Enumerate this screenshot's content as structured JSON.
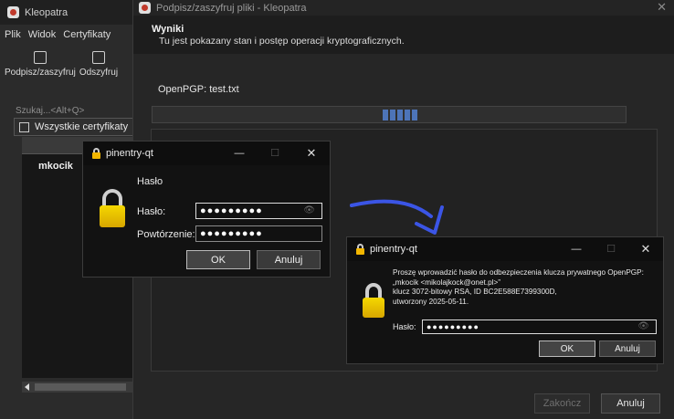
{
  "main_window": {
    "title": "Kleopatra",
    "menu": [
      "Plik",
      "Widok",
      "Certyfikaty"
    ],
    "toolbar": {
      "sign_encrypt": "Podpisz/zaszyfruj",
      "decrypt": "Odszyfruj"
    },
    "search_placeholder": "Szukaj...<Alt+Q>",
    "filter_label": "Wszystkie certyfikaty",
    "list_user": "mkocik"
  },
  "dialog": {
    "title": "Podpisz/zaszyfruj pliki - Kleopatra",
    "header_title": "Wyniki",
    "header_subtitle": "Tu jest pokazany stan i postęp operacji kryptograficznych.",
    "operation": "OpenPGP: test.txt",
    "finish_button": "Zakończ",
    "cancel_button": "Anuluj"
  },
  "pinentry_left": {
    "title": "pinentry-qt",
    "heading": "Hasło",
    "password_label": "Hasło:",
    "password_value": "●●●●●●●●●",
    "repeat_label": "Powtórzenie:",
    "repeat_value": "●●●●●●●●●",
    "ok_button": "OK",
    "cancel_button": "Anuluj"
  },
  "pinentry_right": {
    "title": "pinentry-qt",
    "message_line1": "Proszę wprowadzić hasło do odbezpieczenia klucza prywatnego OpenPGP:",
    "message_line2": "„mkocik <mikolajkock@onet.pl>”",
    "message_line3": "klucz 3072-bitowy RSA, ID BC2E588E7399300D,",
    "message_line4": "utworzony 2025-05-11.",
    "password_label": "Hasło:",
    "password_value": "●●●●●●●●●",
    "ok_button": "OK",
    "cancel_button": "Anuluj"
  },
  "colors": {
    "accent": "#4d74b8",
    "lock_yellow": "#f2b600",
    "arrow_blue": "#3b55e6"
  }
}
